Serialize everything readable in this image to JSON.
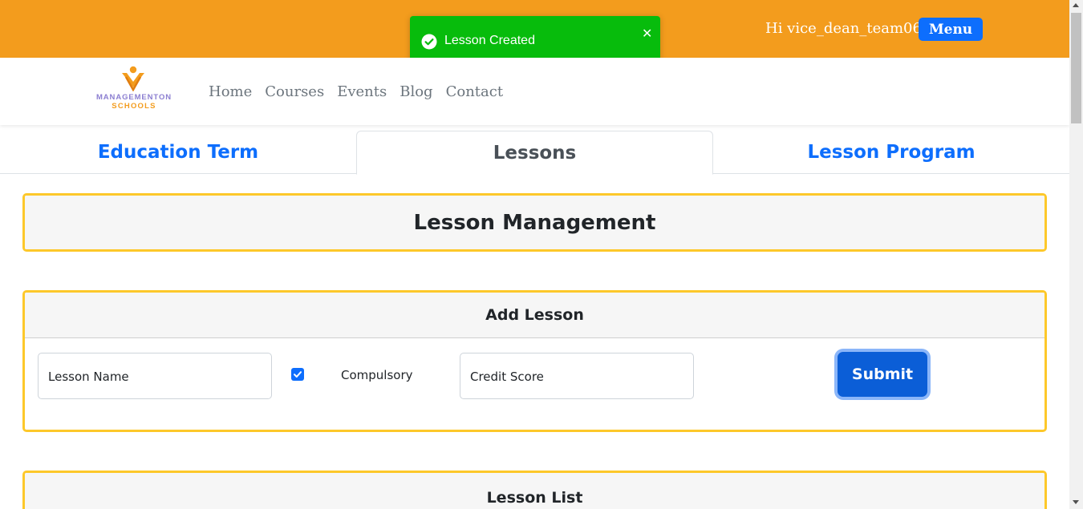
{
  "header": {
    "greeting": "Hi vice_dean_team06",
    "menu_label": "Menu"
  },
  "toast": {
    "icon": "check-circle-icon",
    "message": "Lesson Created",
    "close_icon": "close-icon",
    "close_glyph": "✕",
    "color": "#07bc0c"
  },
  "logo": {
    "line1": "MANAGEMENTON",
    "line2": "SCHOOLS"
  },
  "nav": {
    "links": [
      "Home",
      "Courses",
      "Events",
      "Blog",
      "Contact"
    ]
  },
  "tabs": [
    {
      "label": "Education Term"
    },
    {
      "label": "Lessons"
    },
    {
      "label": "Lesson Program"
    }
  ],
  "main": {
    "title": "Lesson Management",
    "add_lesson": {
      "title": "Add Lesson",
      "lesson_name_placeholder": "Lesson Name",
      "compulsory_label": "Compulsory",
      "compulsory_checked": true,
      "credit_score_placeholder": "Credit Score",
      "submit_label": "Submit"
    },
    "lesson_list": {
      "title": "Lesson List"
    }
  },
  "colors": {
    "topbar": "#f39c1d",
    "accent": "#0d6efd",
    "card_border": "#fdc82a"
  }
}
